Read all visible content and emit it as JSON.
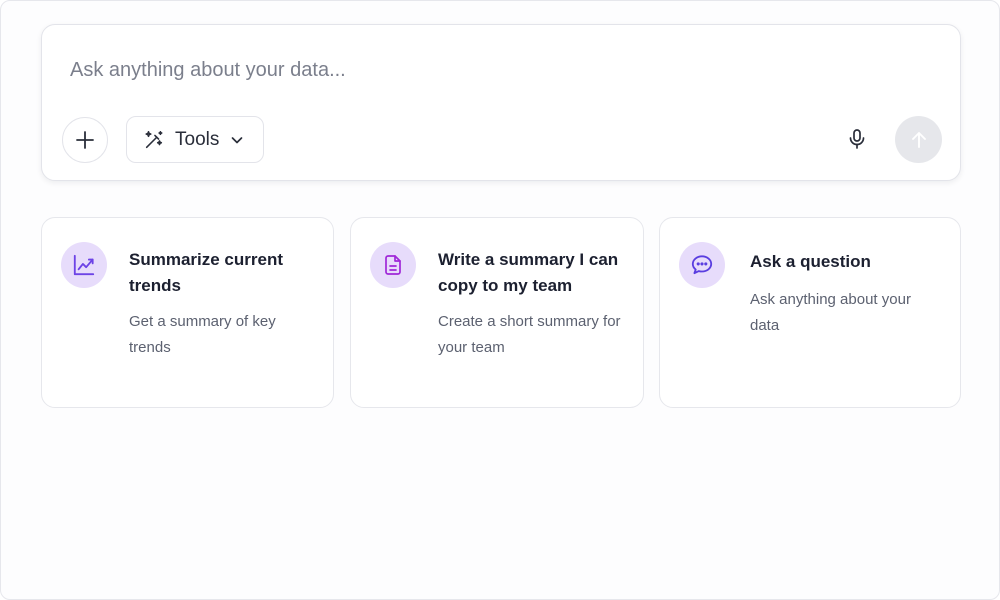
{
  "composer": {
    "placeholder": "Ask anything about your data...",
    "tools_label": "Tools",
    "icons": {
      "add": "plus-icon",
      "tools": "wand-icon",
      "tools_menu": "chevron-down-icon",
      "voice": "microphone-icon",
      "send": "arrow-up-icon"
    }
  },
  "suggestions": [
    {
      "title": "Summarize current trends",
      "description": "Get a summary of key trends",
      "icon": "trend-line-chart-icon"
    },
    {
      "title": "Write a summary I can copy to my team",
      "description": "Create a short summary for your team",
      "icon": "document-icon"
    },
    {
      "title": "Ask a question",
      "description": "Ask anything about your data",
      "icon": "chat-bubble-icon"
    }
  ],
  "colors": {
    "accent": "#7c4dff",
    "icon_bg": "#e7dcfb",
    "send_disabled_bg": "#e6e7eb",
    "border": "#e3e4ea"
  }
}
